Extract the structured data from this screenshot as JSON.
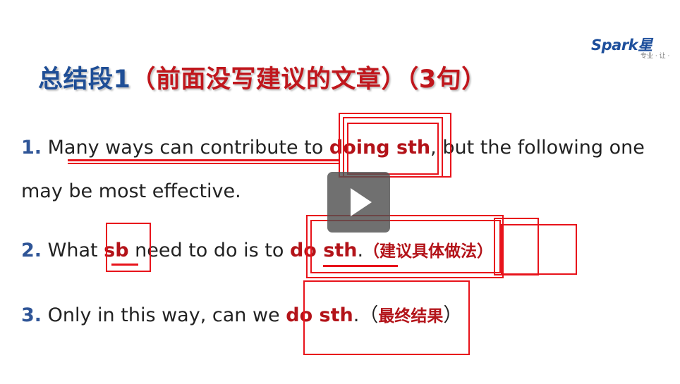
{
  "logo": {
    "brand": "Spark",
    "brand_cn": "星",
    "slogan": "专业 · 让 ·"
  },
  "title": {
    "main": "总结段1",
    "paren": "（前面没写建议的文章）（3句）"
  },
  "lines": {
    "l1a": {
      "num": "1.",
      "pre": " Many ways can contribute to ",
      "hl": "doing sth",
      "post": ", but the following one"
    },
    "l1b": {
      "text": "may be most effective."
    },
    "l2": {
      "num": "2.",
      "pre": " What ",
      "hl1": "sb",
      "mid": " need to do is to ",
      "hl2": "do sth",
      "post": ".",
      "note": "（建议具体做法）"
    },
    "l3": {
      "num": "3.",
      "pre": " Only in this way, can we ",
      "hl": "do sth",
      "post": ".（",
      "note": "最终结果",
      "close": "）"
    }
  },
  "player": {
    "icon": "play-icon"
  },
  "colors": {
    "title_blue": "#1f4e96",
    "highlight_red": "#b31319",
    "annotation_red": "#e8131b"
  }
}
